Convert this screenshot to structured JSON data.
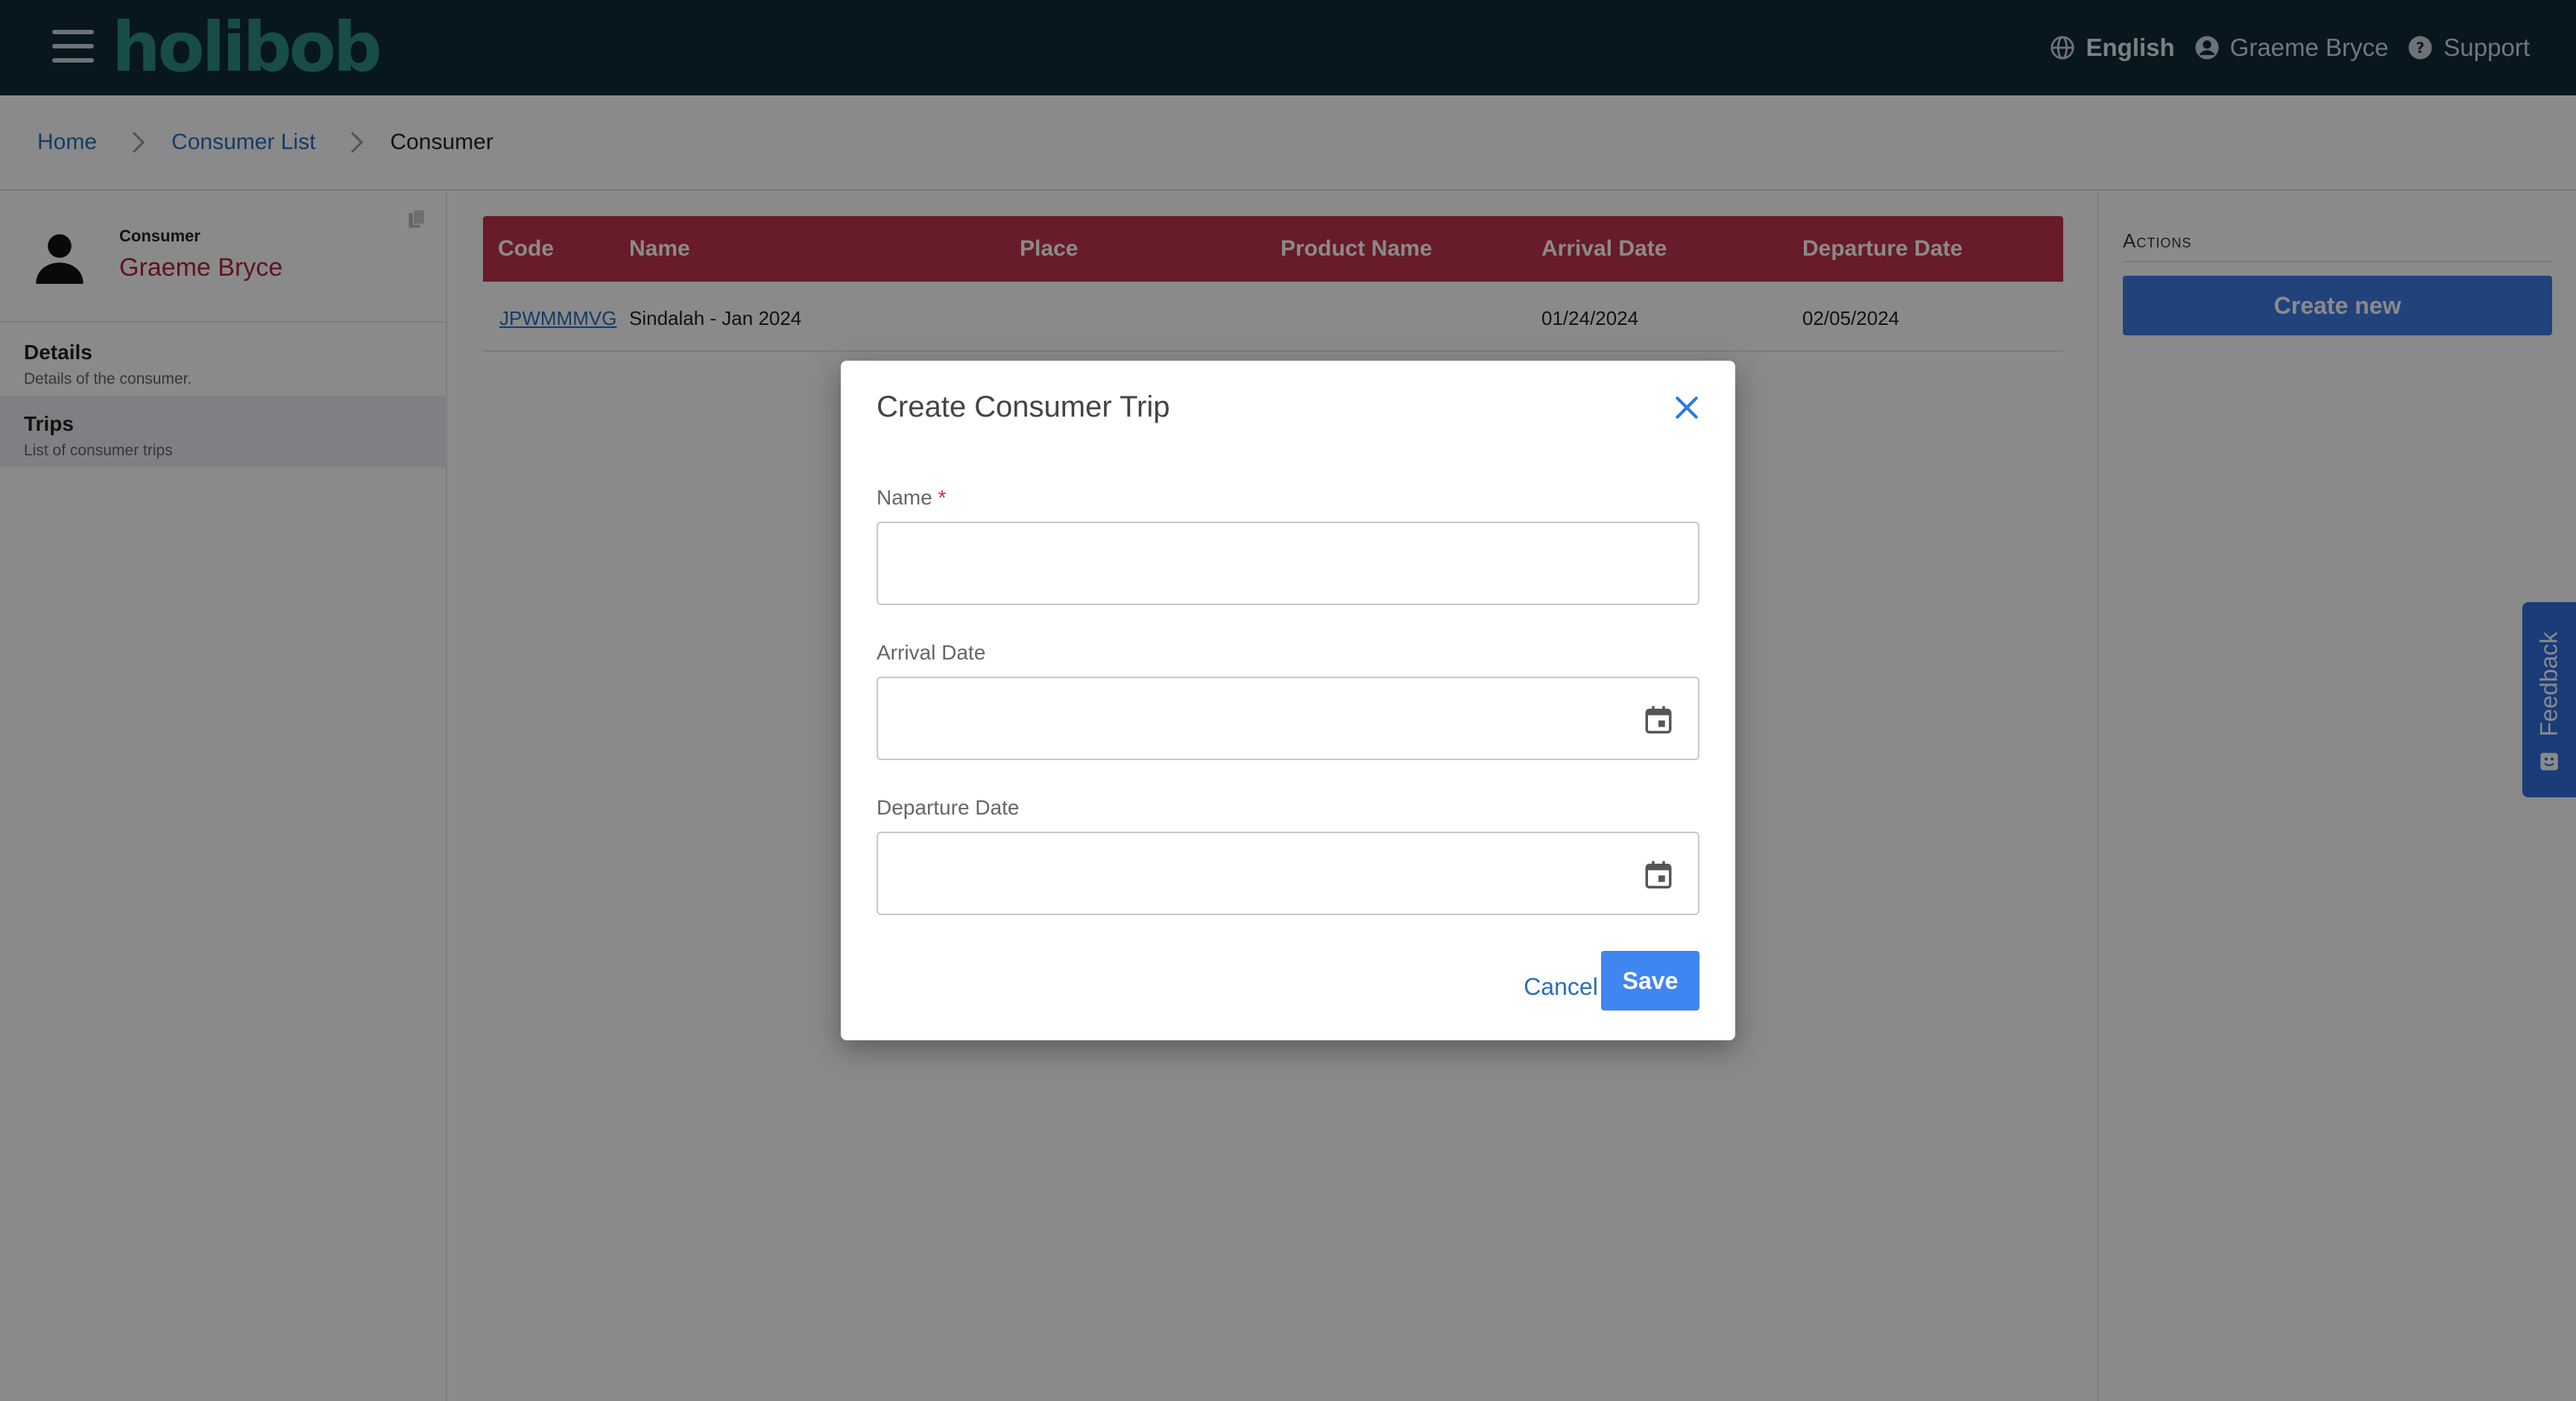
{
  "topbar": {
    "logo": "holibob",
    "language": "English",
    "user": "Graeme Bryce",
    "support": "Support",
    "icons": [
      "menu-icon",
      "globe-icon",
      "account-circle-icon",
      "help-circle-icon"
    ]
  },
  "breadcrumb": {
    "items": [
      "Home",
      "Consumer List",
      "Consumer"
    ]
  },
  "sidebar": {
    "consumer_label": "Consumer",
    "consumer_name": "Graeme Bryce",
    "items": [
      {
        "title": "Details",
        "subtitle": "Details of the consumer."
      },
      {
        "title": "Trips",
        "subtitle": "List of consumer trips"
      }
    ]
  },
  "table": {
    "columns": [
      "Code",
      "Name",
      "Place",
      "Product Name",
      "Arrival Date",
      "Departure Date"
    ],
    "rows": [
      {
        "code": "JPWMMMVG",
        "name": "Sindalah - Jan 2024",
        "place": "",
        "product": "",
        "arrival": "01/24/2024",
        "departure": "02/05/2024"
      }
    ]
  },
  "actions": {
    "title": "Actions",
    "create_label": "Create new"
  },
  "feedback": {
    "label": "Feedback"
  },
  "dialog": {
    "title": "Create Consumer Trip",
    "name_label": "Name",
    "required_mark": "*",
    "name_value": "",
    "arrival_label": "Arrival Date",
    "arrival_value": "",
    "departure_label": "Departure Date",
    "departure_value": "",
    "cancel_label": "Cancel",
    "save_label": "Save"
  },
  "colors": {
    "topbar_bg": "#0f2a3a",
    "logo": "#2e8c85",
    "table_header": "#c0324a",
    "consumer_name": "#b3243a",
    "primary_button": "#3f86f0",
    "link": "#2a6ebb"
  }
}
